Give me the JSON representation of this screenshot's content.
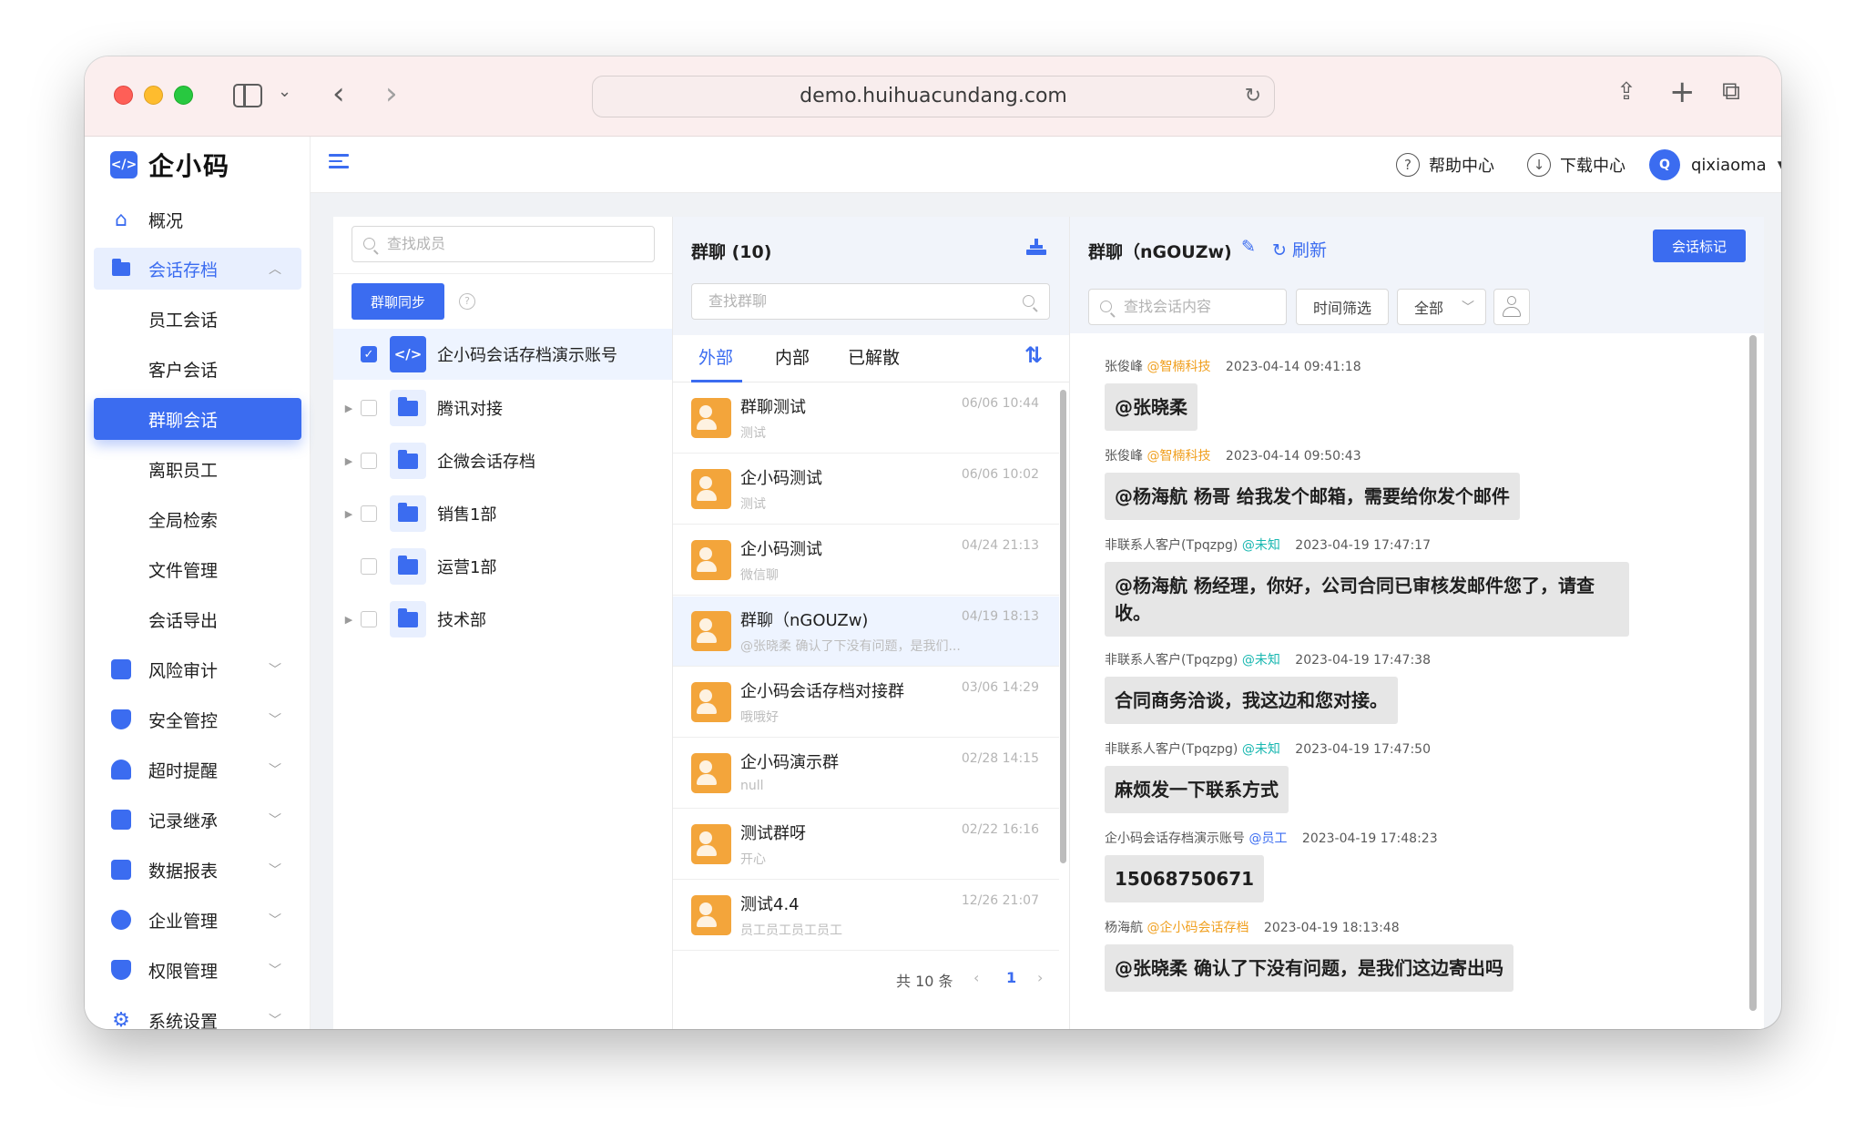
{
  "browser": {
    "url": "demo.huihuacundang.com"
  },
  "app": {
    "logo_text": "企小码",
    "logo_glyph": "</>"
  },
  "sidebar": {
    "items": [
      {
        "label": "概况"
      },
      {
        "label": "会话存档"
      },
      {
        "label": "员工会话"
      },
      {
        "label": "客户会话"
      },
      {
        "label": "群聊会话"
      },
      {
        "label": "离职员工"
      },
      {
        "label": "全局检索"
      },
      {
        "label": "文件管理"
      },
      {
        "label": "会话导出"
      },
      {
        "label": "风险审计"
      },
      {
        "label": "安全管控"
      },
      {
        "label": "超时提醒"
      },
      {
        "label": "记录继承"
      },
      {
        "label": "数据报表"
      },
      {
        "label": "企业管理"
      },
      {
        "label": "权限管理"
      },
      {
        "label": "系统设置"
      }
    ]
  },
  "header": {
    "help": "帮助中心",
    "download": "下载中心",
    "user_initial": "Q",
    "username": "qixiaoma"
  },
  "org": {
    "search_placeholder": "查找成员",
    "sync_button": "群聊同步",
    "nodes": [
      {
        "label": "企小码会话存档演示账号"
      },
      {
        "label": "腾讯对接"
      },
      {
        "label": "企微会话存档"
      },
      {
        "label": "销售1部"
      },
      {
        "label": "运营1部"
      },
      {
        "label": "技术部"
      }
    ]
  },
  "group_list": {
    "title": "群聊 (10)",
    "search_placeholder": "查找群聊",
    "tabs": [
      "外部",
      "内部",
      "已解散"
    ],
    "rows": [
      {
        "name": "群聊测试",
        "sub": "测试",
        "time": "06/06 10:44"
      },
      {
        "name": "企小码测试",
        "sub": "测试",
        "time": "06/06 10:02"
      },
      {
        "name": "企小码测试",
        "sub": "微信聊",
        "time": "04/24 21:13"
      },
      {
        "name": "群聊（nGOUZw)",
        "sub": "@张晓柔 确认了下没有问题，是我们...",
        "time": "04/19 18:13"
      },
      {
        "name": "企小码会话存档对接群",
        "sub": "哦哦好",
        "time": "03/06 14:29"
      },
      {
        "name": "企小码演示群",
        "sub": "null",
        "time": "02/28 14:15"
      },
      {
        "name": "测试群呀",
        "sub": "开心",
        "time": "02/22 16:16"
      },
      {
        "name": "测试4.4",
        "sub": "员工员工员工员工",
        "time": "12/26 21:07"
      }
    ],
    "total": "共 10 条",
    "page": "1"
  },
  "chat": {
    "title": "群聊（nGOUZw)",
    "refresh": "刷新",
    "mark_button": "会话标记",
    "search_placeholder": "查找会话内容",
    "time_filter": "时间筛选",
    "scope_select": "全部",
    "messages": [
      {
        "sender": "张俊峰",
        "tag": "@智楠科技",
        "time": "2023-04-14 09:41:18",
        "text": "@张晓柔"
      },
      {
        "sender": "张俊峰",
        "tag": "@智楠科技",
        "time": "2023-04-14 09:50:43",
        "text": "@杨海航 杨哥 给我发个邮箱，需要给你发个邮件"
      },
      {
        "sender": "非联系人客户(Tpqzpg)",
        "tag": "@未知",
        "time": "2023-04-19 17:47:17",
        "text": "@杨海航 杨经理，你好，公司合同已审核发邮件您了，请查收。"
      },
      {
        "sender": "非联系人客户(Tpqzpg)",
        "tag": "@未知",
        "time": "2023-04-19 17:47:38",
        "text": "合同商务洽谈，我这边和您对接。"
      },
      {
        "sender": "非联系人客户(Tpqzpg)",
        "tag": "@未知",
        "time": "2023-04-19 17:47:50",
        "text": "麻烦发一下联系方式"
      },
      {
        "sender": "企小码会话存档演示账号",
        "tag": "@员工",
        "time": "2023-04-19 17:48:23",
        "text": "15068750671"
      },
      {
        "sender": "杨海航",
        "tag": "@企小码会话存档",
        "time": "2023-04-19 18:13:48",
        "text": "@张晓柔 确认了下没有问题，是我们这边寄出吗"
      }
    ]
  },
  "colors": {
    "accent": "#3b6cf0",
    "group_icon": "#f3a53b",
    "tag_company": "#f0a020",
    "tag_unknown": "#18b7b0"
  }
}
